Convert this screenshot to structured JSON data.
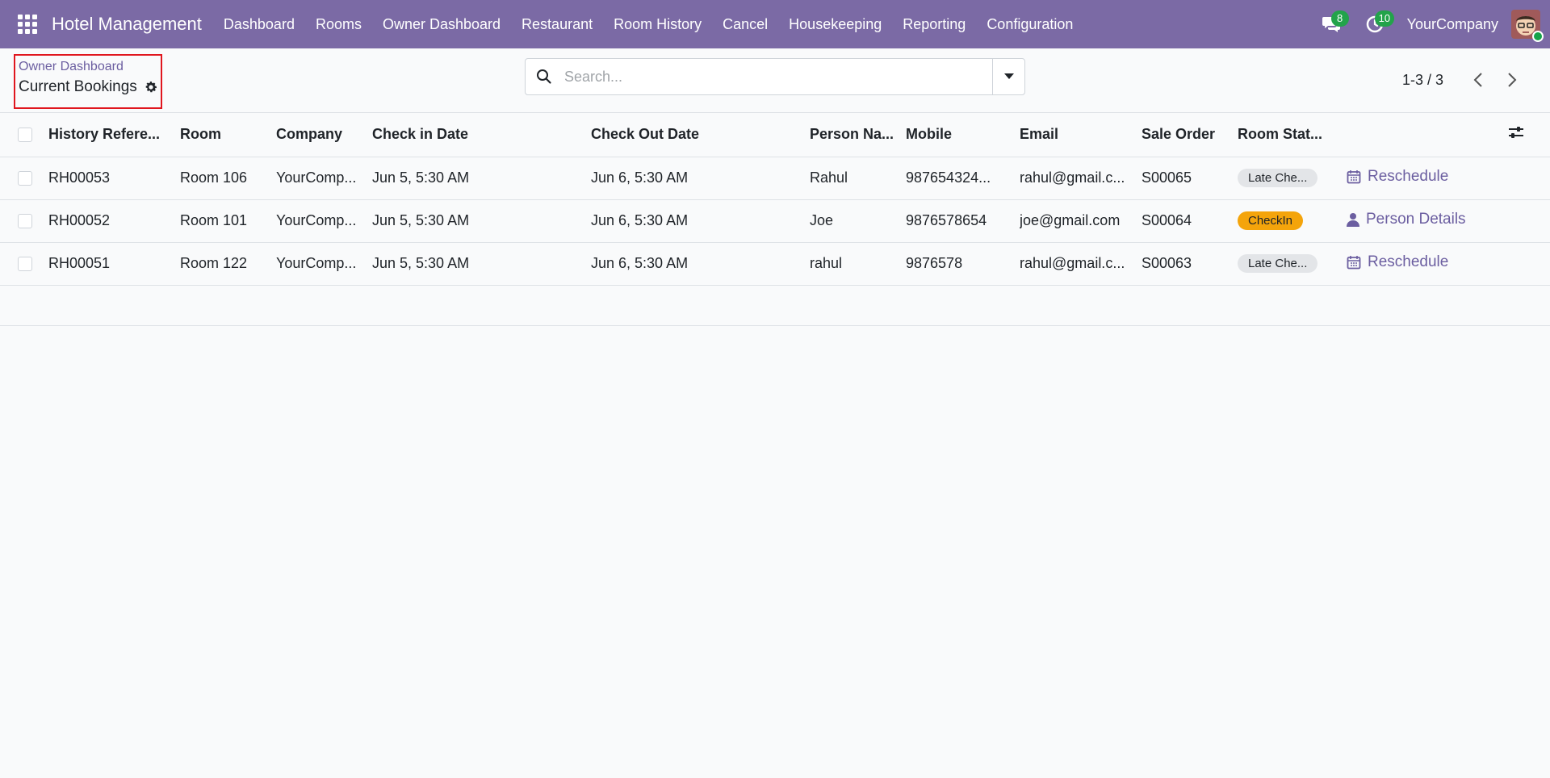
{
  "navbar": {
    "app_title": "Hotel Management",
    "menu": [
      "Dashboard",
      "Rooms",
      "Owner Dashboard",
      "Restaurant",
      "Room History",
      "Cancel",
      "Housekeeping",
      "Reporting",
      "Configuration"
    ],
    "messages_count": "8",
    "activities_count": "10",
    "company": "YourCompany",
    "badge_color": "#22a34a",
    "bar_color": "#7b6aa5"
  },
  "breadcrumb": {
    "parent": "Owner Dashboard",
    "current": "Current Bookings"
  },
  "search": {
    "placeholder": "Search..."
  },
  "pager": {
    "value": "1-3 / 3"
  },
  "table": {
    "columns": [
      "History Refere...",
      "Room",
      "Company",
      "Check in Date",
      "Check Out Date",
      "Person Na...",
      "Mobile",
      "Email",
      "Sale Order",
      "Room Stat..."
    ],
    "rows": [
      {
        "ref": "RH00053",
        "room": "Room 106",
        "company": "YourComp...",
        "checkin": "Jun 5, 5:30 AM",
        "checkout": "Jun 6, 5:30 AM",
        "person": "Rahul",
        "mobile": "987654324...",
        "email": "rahul@gmail.c...",
        "sale_order": "S00065",
        "status": "Late Che...",
        "action": "Reschedule"
      },
      {
        "ref": "RH00052",
        "room": "Room 101",
        "company": "YourComp...",
        "checkin": "Jun 5, 5:30 AM",
        "checkout": "Jun 6, 5:30 AM",
        "person": "Joe",
        "mobile": "9876578654",
        "email": "joe@gmail.com",
        "sale_order": "S00064",
        "status": "CheckIn",
        "action": "Person Details"
      },
      {
        "ref": "RH00051",
        "room": "Room 122",
        "company": "YourComp...",
        "checkin": "Jun 5, 5:30 AM",
        "checkout": "Jun 6, 5:30 AM",
        "person": "rahul",
        "mobile": "9876578",
        "email": "rahul@gmail.c...",
        "sale_order": "S00063",
        "status": "Late Che...",
        "action": "Reschedule"
      }
    ]
  }
}
